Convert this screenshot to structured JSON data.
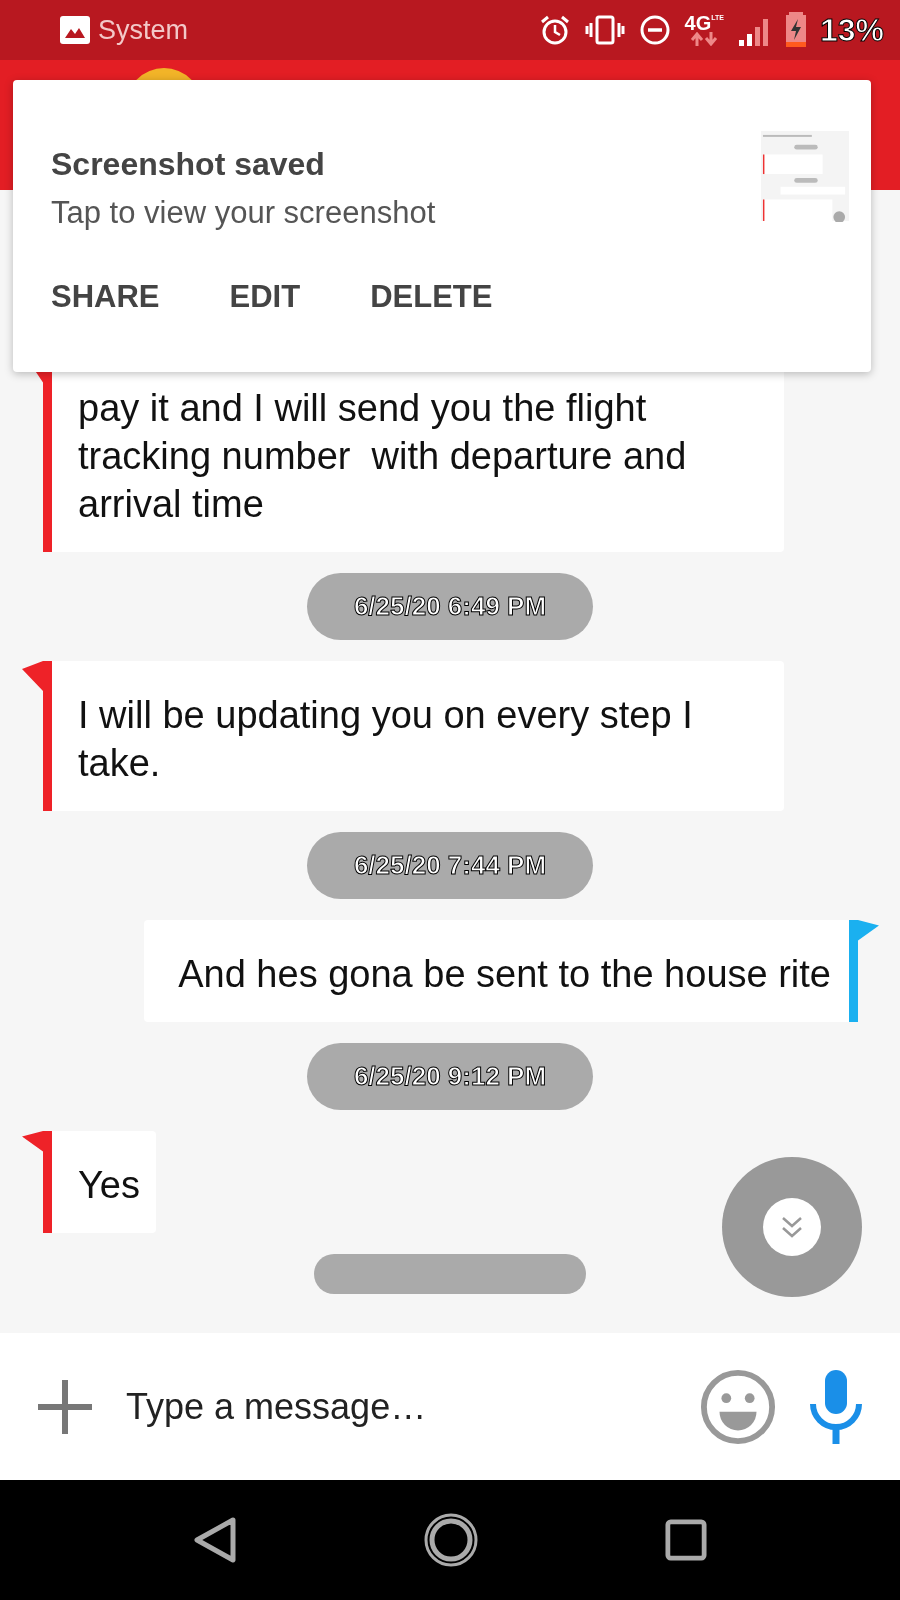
{
  "status_bar": {
    "notification_label": "System",
    "network": "4G",
    "network_sub": "LTE",
    "battery": "13%"
  },
  "notification": {
    "title": "Screenshot saved",
    "text": "Tap to view your screenshot",
    "actions": [
      "SHARE",
      "EDIT",
      "DELETE"
    ]
  },
  "messages": [
    {
      "kind": "incoming",
      "text": "pay it and I will send you the flight tracking number  with departure and arrival time"
    },
    {
      "kind": "timestamp",
      "text": "6/25/20 6:49 PM"
    },
    {
      "kind": "incoming",
      "text": "I will be updating you on every step I take."
    },
    {
      "kind": "timestamp",
      "text": "6/25/20 7:44 PM"
    },
    {
      "kind": "outgoing",
      "text": " And hes gona be sent to the house rite"
    },
    {
      "kind": "timestamp",
      "text": "6/25/20 9:12 PM"
    },
    {
      "kind": "incoming",
      "text": "Yes"
    }
  ],
  "composer": {
    "placeholder": "Type a message…"
  }
}
